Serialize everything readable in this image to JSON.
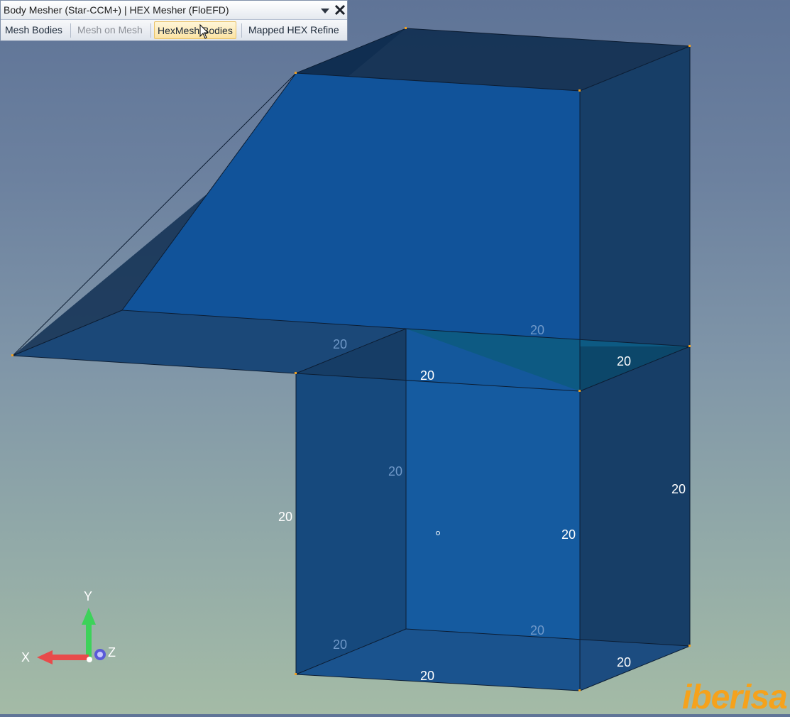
{
  "toolbar": {
    "title": "Body Mesher (Star-CCM+) | HEX Mesher (FloEFD)",
    "buttons": [
      {
        "label": "Mesh Bodies",
        "state": "normal"
      },
      {
        "label": "Mesh on Mesh",
        "state": "disabled"
      },
      {
        "label": "HexMesh Bodies",
        "state": "active"
      },
      {
        "label": "Mapped HEX Refine",
        "state": "normal"
      }
    ],
    "icons": [
      "chevron-down-icon",
      "close-icon"
    ]
  },
  "viewport": {
    "mesh_labels": {
      "top_back_left": "20",
      "top_back_right": "20",
      "top_front": "20",
      "top_right": "20",
      "left_vertical_back": "20",
      "left_vertical_front": "20",
      "center_vertical": "20",
      "right_vertical": "20",
      "bottom_back_left": "20",
      "bottom_back_right": "20",
      "bottom_front": "20",
      "bottom_right": "20"
    },
    "axes": {
      "y": "Y",
      "x": "X",
      "z": "Z"
    },
    "colors": {
      "body_face": "#11559c",
      "edge": "#0d1f36",
      "vertex": "#f0a020",
      "highlight_face": "#0e6a96",
      "axis_x": "#e84b4b",
      "axis_y": "#3dd25a",
      "axis_z": "#5a5ad8"
    }
  },
  "watermark": "iberisa"
}
